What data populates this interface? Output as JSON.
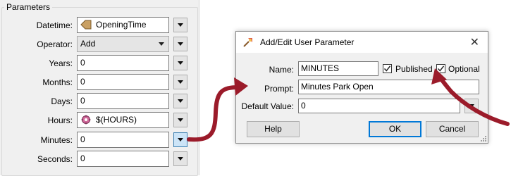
{
  "parameters": {
    "title": "Parameters",
    "rows": [
      {
        "label": "Datetime:",
        "value": "OpeningTime",
        "kind": "attribute",
        "icon": "attribute-icon"
      },
      {
        "label": "Operator:",
        "value": "Add",
        "kind": "combo"
      },
      {
        "label": "Years:",
        "value": "0",
        "kind": "text"
      },
      {
        "label": "Months:",
        "value": "0",
        "kind": "text"
      },
      {
        "label": "Days:",
        "value": "0",
        "kind": "text"
      },
      {
        "label": "Hours:",
        "value": "$(HOURS)",
        "kind": "parameter",
        "icon": "user-parameter-icon"
      },
      {
        "label": "Minutes:",
        "value": "0",
        "kind": "text",
        "menu_active": true
      },
      {
        "label": "Seconds:",
        "value": "0",
        "kind": "text"
      }
    ]
  },
  "dialog": {
    "title": "Add/Edit User Parameter",
    "close_glyph": "✕",
    "name_label": "Name:",
    "name_value": "MINUTES",
    "published_label": "Published",
    "published_checked": true,
    "optional_label": "Optional",
    "optional_checked": true,
    "prompt_label": "Prompt:",
    "prompt_value": "Minutes Park Open",
    "default_label": "Default Value:",
    "default_value": "0",
    "help_label": "Help",
    "ok_label": "OK",
    "cancel_label": "Cancel"
  },
  "colors": {
    "arrow": "#9b1b2a",
    "panel_bg": "#f0f0f0",
    "accent": "#0078d7"
  }
}
